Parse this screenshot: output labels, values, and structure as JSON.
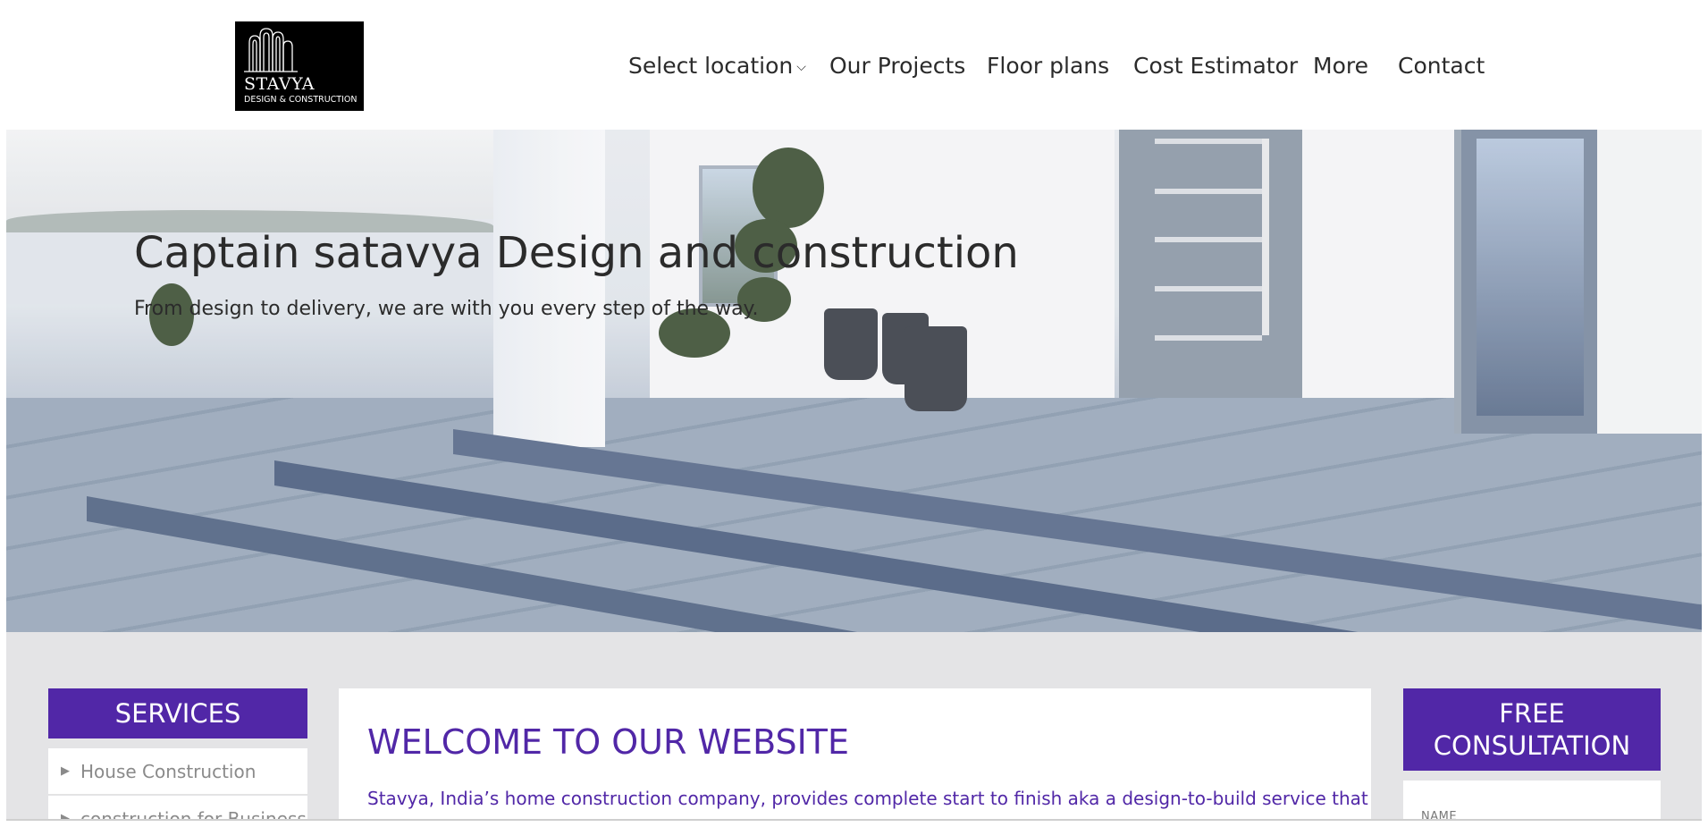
{
  "brand": {
    "name": "STAVYA",
    "tagline": "DESIGN & CONSTRUCTION"
  },
  "nav": {
    "items": [
      {
        "label": "Select location",
        "has_dropdown": true,
        "icon": "chevron-down-icon"
      },
      {
        "label": "Our Projects"
      },
      {
        "label": "Floor plans"
      },
      {
        "label": "Cost Estimator"
      },
      {
        "label": "More"
      },
      {
        "label": "Contact"
      }
    ]
  },
  "hero": {
    "title": "Captain satavya Design and construction",
    "subtitle": "From design to delivery, we are with you every step of the way."
  },
  "services": {
    "heading": "SERVICES",
    "items": [
      {
        "label": "House Construction"
      },
      {
        "label": "construction for Business"
      }
    ]
  },
  "welcome": {
    "title": "WELCOME TO OUR WEBSITE",
    "text": "Stavya, India’s home construction company, provides complete start to finish aka a design-to-build service that"
  },
  "consultation": {
    "heading_line1": "FREE",
    "heading_line2": "CONSULTATION",
    "name_label": "NAME"
  },
  "colors": {
    "accent": "#5127a7",
    "nav_text": "#2b2b2b",
    "section_bg": "#e4e4e6"
  }
}
